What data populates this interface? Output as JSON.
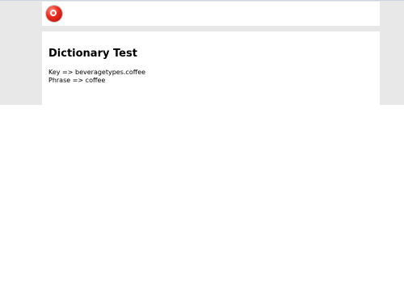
{
  "header": {
    "logo_icon": "red-circle-logo-icon"
  },
  "main": {
    "title": "Dictionary Test",
    "rows": [
      {
        "text": "Key => beveragetypes.coffee"
      },
      {
        "text": "Phrase => coffee"
      }
    ]
  },
  "colors": {
    "background": "#e8e8e8",
    "card": "#ffffff",
    "logo_red": "#e8281c"
  }
}
